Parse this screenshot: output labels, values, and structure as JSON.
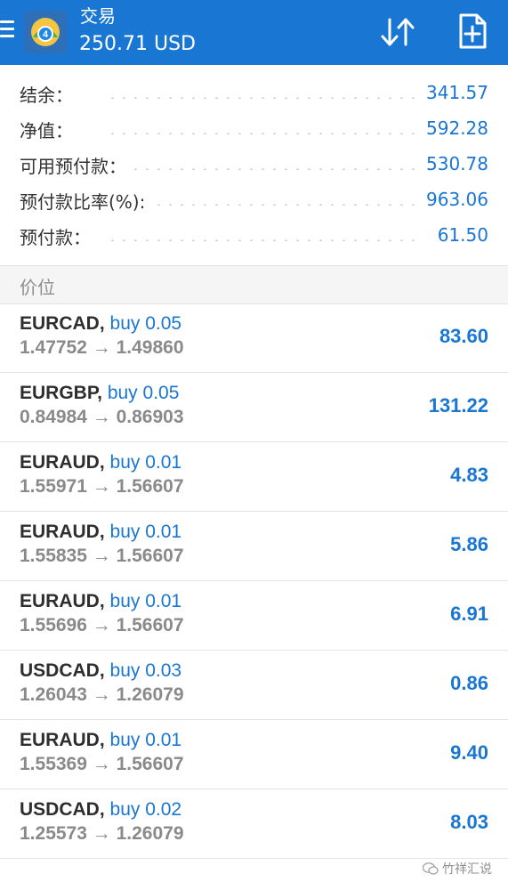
{
  "header": {
    "title": "交易",
    "balance": "250.71 USD",
    "icons": {
      "menu": "menu-icon",
      "logo": "metatrader-logo",
      "sort": "sort-icon",
      "new_order": "new-order-icon"
    },
    "colors": {
      "bar": "#1976d2",
      "text": "#ffffff"
    }
  },
  "summary": [
    {
      "label": "结余：",
      "value": "341.57"
    },
    {
      "label": "净值：",
      "value": "592.28"
    },
    {
      "label": "可用预付款：",
      "value": "530.78"
    },
    {
      "label": "预付款比率(%):",
      "value": "963.06"
    },
    {
      "label": "预付款：",
      "value": "61.50"
    }
  ],
  "section": {
    "label": "价位"
  },
  "positions": [
    {
      "symbol": "EURCAD",
      "side": "buy 0.05",
      "open": "1.47752",
      "current": "1.49860",
      "profit": "83.60"
    },
    {
      "symbol": "EURGBP",
      "side": "buy 0.05",
      "open": "0.84984",
      "current": "0.86903",
      "profit": "131.22"
    },
    {
      "symbol": "EURAUD",
      "side": "buy 0.01",
      "open": "1.55971",
      "current": "1.56607",
      "profit": "4.83"
    },
    {
      "symbol": "EURAUD",
      "side": "buy 0.01",
      "open": "1.55835",
      "current": "1.56607",
      "profit": "5.86"
    },
    {
      "symbol": "EURAUD",
      "side": "buy 0.01",
      "open": "1.55696",
      "current": "1.56607",
      "profit": "6.91"
    },
    {
      "symbol": "USDCAD",
      "side": "buy 0.03",
      "open": "1.26043",
      "current": "1.26079",
      "profit": "0.86"
    },
    {
      "symbol": "EURAUD",
      "side": "buy 0.01",
      "open": "1.55369",
      "current": "1.56607",
      "profit": "9.40"
    },
    {
      "symbol": "USDCAD",
      "side": "buy 0.02",
      "open": "1.25573",
      "current": "1.26079",
      "profit": "8.03"
    }
  ],
  "labels": {
    "comma": ",",
    "arrow": "→"
  },
  "watermark": {
    "text": "竹祥汇说",
    "icon": "wechat-icon"
  },
  "colors": {
    "accent": "#1976d2",
    "muted": "#8a8a8a",
    "separator_bg": "#f5f5f5"
  }
}
